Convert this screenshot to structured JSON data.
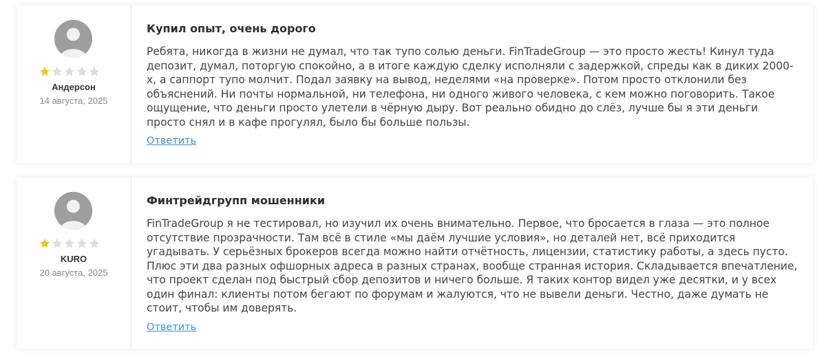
{
  "reviews": [
    {
      "title": "Купил опыт, очень дорого",
      "text": "Ребята, никогда в жизни не думал, что так тупо солью деньги. FinTradeGroup — это просто жесть! Кинул туда депозит, думал, поторгую спокойно, а в итоге каждую сделку исполняли с задержкой, спреды как в диких 2000-х, а саппорт тупо молчит. Подал заявку на вывод, неделями «на проверке». Потом просто отклонили без объяснений. Ни почты нормальной, ни телефона, ни одного живого человека, с кем можно поговорить. Такое ощущение, что деньги просто улетели в чёрную дыру. Вот реально обидно до слёз, лучше бы я эти деньги просто снял и в кафе прогулял, было бы больше пользы.",
      "author": "Андерсон",
      "date": "14 августа, 2025",
      "rating": 1,
      "max_rating": 5,
      "reply_label": "Ответить"
    },
    {
      "title": "Финтрейдгрупп мошенники",
      "text": "FinTradeGroup я не тестировал, но изучил их очень внимательно. Первое, что бросается в глаза — это полное отсутствие прозрачности. Там всё в стиле «мы даём лучшие условия», но деталей нет, всё приходится угадывать. У серьёзных брокеров всегда можно найти отчётность, лицензии, статистику работы, а здесь пусто. Плюс эти два разных офшорных адреса в разных странах, вообще странная история. Складывается впечатление, что проект сделан под быстрый сбор депозитов и ничего больше. Я таких контор видел уже десятки, и у всех один финал: клиенты потом бегают по форумам и жалуются, что не вывели деньги. Честно, даже думать не стоит, чтобы им доверять.",
      "author": "KURO",
      "date": "20 августа, 2025",
      "rating": 1,
      "max_rating": 5,
      "reply_label": "Ответить"
    }
  ],
  "colors": {
    "star_filled": "#f5c518",
    "star_empty": "#dcdcdc",
    "link": "#3a8fd6",
    "avatar_bg": "#9e9e9e"
  },
  "icons": {
    "avatar": "user-avatar-icon",
    "star": "star-icon"
  }
}
